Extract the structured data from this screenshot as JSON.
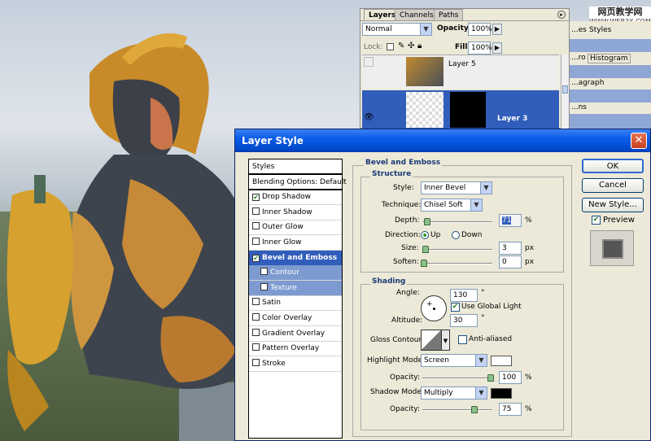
{
  "watermark": {
    "line1": "网页教学网",
    "line2": "WWW.WEB3X.COM"
  },
  "layers_panel": {
    "tabs": [
      "Layers",
      "Channels",
      "Paths"
    ],
    "blend_mode": "Normal",
    "opacity_label": "Opacity:",
    "opacity_value": "100%",
    "lock_label": "Lock:",
    "fill_label": "Fill:",
    "fill_value": "100%",
    "layers": [
      {
        "name": "Layer 5",
        "selected": false
      },
      {
        "name": "Layer 3",
        "selected": true
      }
    ]
  },
  "side_panels": [
    {
      "tabs": [
        "...es",
        "Styles"
      ]
    },
    {
      "tabs": [
        "...ro",
        "Histogram"
      ]
    },
    {
      "tabs": [
        "...agraph"
      ]
    },
    {
      "tabs": [
        "...ns"
      ]
    }
  ],
  "dialog": {
    "title": "Layer Style",
    "close_label": "✕",
    "styles_list": [
      {
        "label": "Styles",
        "type": "head"
      },
      {
        "label": "Blending Options: Default",
        "type": "head"
      },
      {
        "label": "Drop Shadow",
        "checked": true
      },
      {
        "label": "Inner Shadow",
        "checked": false
      },
      {
        "label": "Outer Glow",
        "checked": false
      },
      {
        "label": "Inner Glow",
        "checked": false
      },
      {
        "label": "Bevel and Emboss",
        "checked": true,
        "selected": true
      },
      {
        "label": "Contour",
        "checked": false,
        "sub": true
      },
      {
        "label": "Texture",
        "checked": false,
        "sub": true
      },
      {
        "label": "Satin",
        "checked": false
      },
      {
        "label": "Color Overlay",
        "checked": false
      },
      {
        "label": "Gradient Overlay",
        "checked": false
      },
      {
        "label": "Pattern Overlay",
        "checked": false
      },
      {
        "label": "Stroke",
        "checked": false
      }
    ],
    "section_title": "Bevel and Emboss",
    "structure": {
      "title": "Structure",
      "style_label": "Style:",
      "style_value": "Inner Bevel",
      "technique_label": "Technique:",
      "technique_value": "Chisel Soft",
      "depth_label": "Depth:",
      "depth_value": "71",
      "depth_unit": "%",
      "direction_label": "Direction:",
      "direction_up": "Up",
      "direction_down": "Down",
      "size_label": "Size:",
      "size_value": "3",
      "size_unit": "px",
      "soften_label": "Soften:",
      "soften_value": "0",
      "soften_unit": "px"
    },
    "shading": {
      "title": "Shading",
      "angle_label": "Angle:",
      "angle_value": "130",
      "angle_unit": "°",
      "global_light_label": "Use Global Light",
      "altitude_label": "Altitude:",
      "altitude_value": "30",
      "altitude_unit": "°",
      "gloss_label": "Gloss Contour:",
      "anti_aliased_label": "Anti-aliased",
      "highlight_label": "Highlight Mode:",
      "highlight_value": "Screen",
      "highlight_color": "#ffffff",
      "highlight_opacity_label": "Opacity:",
      "highlight_opacity_value": "100",
      "highlight_opacity_unit": "%",
      "shadow_label": "Shadow Mode:",
      "shadow_value": "Multiply",
      "shadow_color": "#000000",
      "shadow_opacity_label": "Opacity:",
      "shadow_opacity_value": "75",
      "shadow_opacity_unit": "%"
    },
    "buttons": {
      "ok": "OK",
      "cancel": "Cancel",
      "new_style": "New Style...",
      "preview": "Preview"
    }
  }
}
